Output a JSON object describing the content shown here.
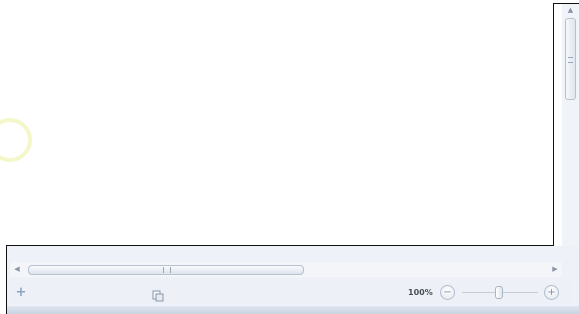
{
  "statusbar": {
    "zoom_label": "100%",
    "zoom_level_percent": 100,
    "zoom_out_label": "−",
    "zoom_in_label": "+",
    "add_label": "+"
  },
  "icons": {
    "add": "plus-icon",
    "page": "page-view-icon",
    "zoom_out": "minus-icon",
    "zoom_in": "plus-icon"
  },
  "scrollbars": {
    "up_arrow": "▲",
    "down_arrow": "▼",
    "left_arrow": "◀",
    "right_arrow": "▶"
  }
}
